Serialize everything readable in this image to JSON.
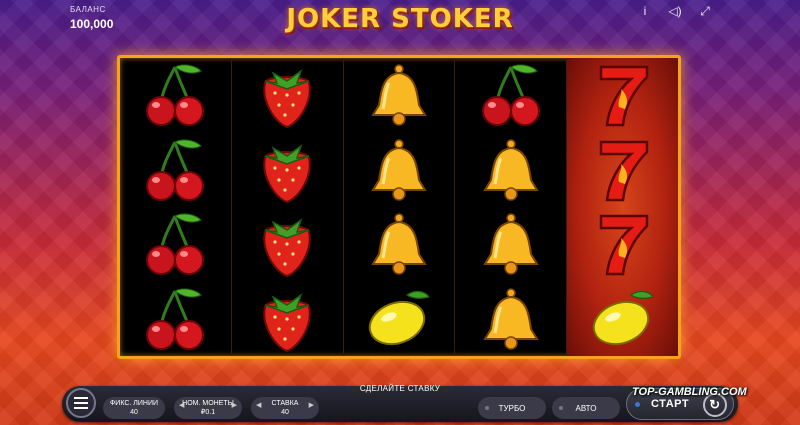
{
  "balance": {
    "label": "БАЛАНС",
    "value": "100,000"
  },
  "title": "JOKER STOKER",
  "top_icons": [
    {
      "name": "info-icon",
      "glyph": "i"
    },
    {
      "name": "sound-icon",
      "glyph": "◁)"
    },
    {
      "name": "fullscreen-icon",
      "glyph": "⤢"
    }
  ],
  "reels": [
    [
      "cherry",
      "cherry",
      "cherry",
      "cherry"
    ],
    [
      "strawberry",
      "strawberry",
      "strawberry",
      "strawberry"
    ],
    [
      "bell",
      "bell",
      "bell",
      "lemon"
    ],
    [
      "cherry",
      "bell",
      "bell",
      "bell"
    ],
    [
      "seven",
      "seven",
      "seven",
      "lemon"
    ]
  ],
  "bet_prompt": "СДЕЛАЙТЕ СТАВКУ",
  "controls": {
    "lines": {
      "label": "ФИКС. ЛИНИИ",
      "value": "40"
    },
    "coin": {
      "label": "НОМ. МОНЕТЫ",
      "value": "₽0.1"
    },
    "bet": {
      "label": "СТАВКА",
      "value": "40"
    },
    "turbo": "ТУРБО",
    "auto": "АВТО",
    "start": "СТАРТ"
  },
  "watermark": "TOP-GAMBLING.COM"
}
